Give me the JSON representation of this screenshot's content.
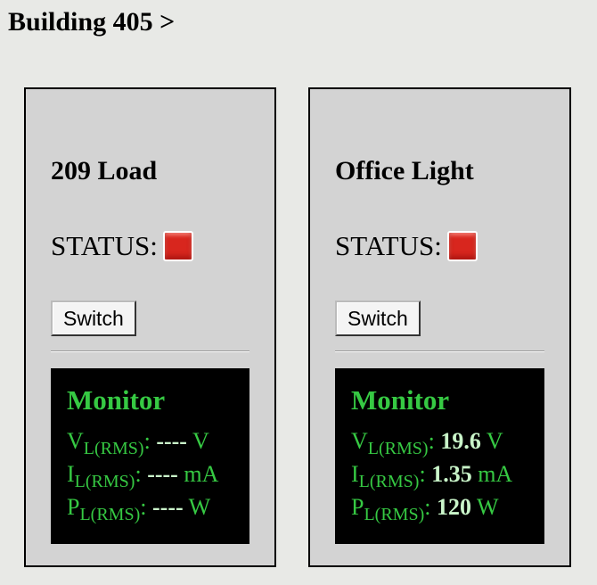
{
  "page": {
    "title": "Building 405 >"
  },
  "colors": {
    "background": "#e8e9e6",
    "card": "#d3d3d3",
    "monitor_bg": "#000000",
    "monitor_text": "#36c943",
    "status_off": "#d8261e"
  },
  "devices": [
    {
      "name": "209 Load",
      "status_label": "STATUS:",
      "status_icon": "red-square-icon",
      "switch_label": "Switch",
      "monitor": {
        "title": "Monitor",
        "readings": [
          {
            "symbol": "V",
            "sub": "L(RMS)",
            "sep": ":",
            "value": "----",
            "unit": "V"
          },
          {
            "symbol": "I",
            "sub": "L(RMS)",
            "sep": ":",
            "value": "----",
            "unit": "mA"
          },
          {
            "symbol": "P",
            "sub": "L(RMS)",
            "sep": ":",
            "value": "----",
            "unit": "W"
          }
        ]
      }
    },
    {
      "name": "Office Light",
      "status_label": "STATUS:",
      "status_icon": "red-square-icon",
      "switch_label": "Switch",
      "monitor": {
        "title": "Monitor",
        "readings": [
          {
            "symbol": "V",
            "sub": "L(RMS)",
            "sep": ":",
            "value": "19.6",
            "unit": "V"
          },
          {
            "symbol": "I",
            "sub": "L(RMS)",
            "sep": ":",
            "value": "1.35",
            "unit": "mA"
          },
          {
            "symbol": "P",
            "sub": "L(RMS)",
            "sep": ":",
            "value": "120",
            "unit": "W"
          }
        ]
      }
    }
  ]
}
